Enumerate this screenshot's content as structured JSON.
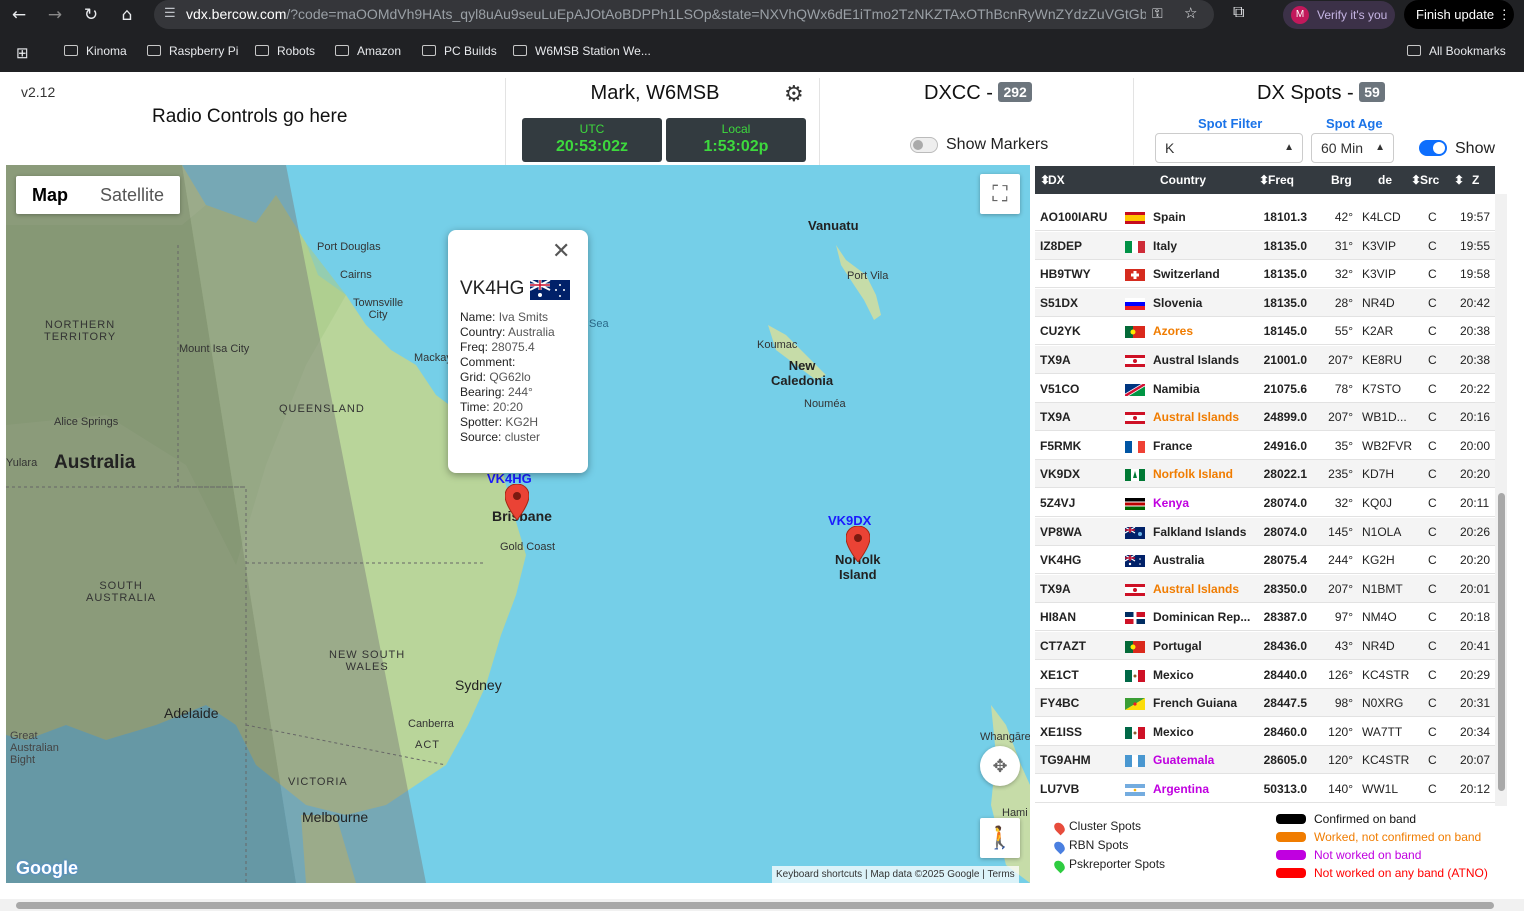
{
  "browser": {
    "url_host": "vdx.bercow.com",
    "url_rest": "/?code=maOOMdVh9HAts_qyl8uAu9seuLuEpAJOtAoBDPPh1LSOp&state=NXVhQWx6dE1iTmo2TzNKZTAxOThBcnRyWnZYdzZuVGtGbm...",
    "verify_label": "Verify it's you",
    "verify_avatar": "M",
    "finish_label": "Finish update",
    "bookmarks": [
      "Kinoma",
      "Raspberry Pi",
      "Robots",
      "Amazon",
      "PC Builds",
      "W6MSB Station We..."
    ],
    "all_bookmarks": "All Bookmarks"
  },
  "header": {
    "version": "v2.12",
    "radio_controls": "Radio Controls go here",
    "operator": "Mark, W6MSB",
    "utc_label": "UTC",
    "utc_time": "20:53:02z",
    "local_label": "Local",
    "local_time": "1:53:02p",
    "dxcc_title": "DXCC -",
    "dxcc_count": "292",
    "show_markers": "Show Markers",
    "spots_title": "DX Spots -",
    "spots_count": "59",
    "spot_filter_label": "Spot Filter",
    "spot_filter_value": "K",
    "spot_age_label": "Spot Age",
    "spot_age_value": "60 Min",
    "show_label": "Show"
  },
  "map": {
    "tab_map": "Map",
    "tab_satellite": "Satellite",
    "labels": {
      "port_douglas": "Port Douglas",
      "cairns": "Cairns",
      "townsville": "Townsville\nCity",
      "northern_territory": "NORTHERN\nTERRITORY",
      "mount_isa": "Mount Isa City",
      "mackay": "Mackay",
      "queensland": "QUEENSLAND",
      "alice_springs": "Alice Springs",
      "australia": "Australia",
      "yulara": "Yulara",
      "south_australia": "SOUTH\nAUSTRALIA",
      "new_south_wales": "NEW SOUTH\nWALES",
      "sydney": "Sydney",
      "adelaide": "Adelaide",
      "canberra": "Canberra",
      "act": "ACT",
      "victoria": "VICTORIA",
      "melbourne": "Melbourne",
      "great_bight": "Great\nAustralian\nBight",
      "gold_coast": "Gold Coast",
      "brisbane": "Brisbane",
      "vanuatu": "Vanuatu",
      "port_vila": "Port Vila",
      "koumac": "Koumac",
      "new_caledonia": "New\nCaledonia",
      "noumea": "Nouméa",
      "norfolk": "Norfolk\nIsland",
      "coral_sea": "Sea",
      "whangarei": "Whangārei",
      "hamilton": "Hami"
    },
    "callouts": {
      "vk4hg": "VK4HG",
      "vk9dx": "VK9DX"
    },
    "popup": {
      "call": "VK4HG",
      "lines": [
        [
          "Name:",
          "Iva Smits"
        ],
        [
          "Country:",
          "Australia"
        ],
        [
          "Freq:",
          "28075.4"
        ],
        [
          "Comment:",
          ""
        ],
        [
          "Grid:",
          "QG62lo"
        ],
        [
          "Bearing:",
          "244°"
        ],
        [
          "Time:",
          "20:20"
        ],
        [
          "Spotter:",
          "KG2H"
        ],
        [
          "Source:",
          "cluster"
        ]
      ]
    },
    "footer": [
      "Keyboard shortcuts",
      "Map data ©2025 Google",
      "Terms"
    ],
    "google": "Google"
  },
  "table": {
    "headers": [
      "DX",
      "Country",
      "Freq",
      "Brg",
      "de",
      "Src",
      "Z"
    ],
    "rows": [
      {
        "dx": "AO100IARU",
        "country": "Spain",
        "freq": "18101.3",
        "brg": "42°",
        "de": "K4LCD",
        "src": "C",
        "z": "19:57",
        "color": "#222",
        "flag": "es"
      },
      {
        "dx": "IZ8DEP",
        "country": "Italy",
        "freq": "18135.0",
        "brg": "31°",
        "de": "K3VIP",
        "src": "C",
        "z": "19:55",
        "color": "#222",
        "flag": "it"
      },
      {
        "dx": "HB9TWY",
        "country": "Switzerland",
        "freq": "18135.0",
        "brg": "32°",
        "de": "K3VIP",
        "src": "C",
        "z": "19:58",
        "color": "#222",
        "flag": "ch"
      },
      {
        "dx": "S51DX",
        "country": "Slovenia",
        "freq": "18135.0",
        "brg": "28°",
        "de": "NR4D",
        "src": "C",
        "z": "20:42",
        "color": "#222",
        "flag": "si"
      },
      {
        "dx": "CU2YK",
        "country": "Azores",
        "freq": "18145.0",
        "brg": "55°",
        "de": "K2AR",
        "src": "C",
        "z": "20:38",
        "color": "#f07c00",
        "flag": "pt"
      },
      {
        "dx": "TX9A",
        "country": "Austral Islands",
        "freq": "21001.0",
        "brg": "207°",
        "de": "KE8RU",
        "src": "C",
        "z": "20:38",
        "color": "#222",
        "flag": "pf"
      },
      {
        "dx": "V51CO",
        "country": "Namibia",
        "freq": "21075.6",
        "brg": "78°",
        "de": "K7STO",
        "src": "C",
        "z": "20:22",
        "color": "#222",
        "flag": "na"
      },
      {
        "dx": "TX9A",
        "country": "Austral Islands",
        "freq": "24899.0",
        "brg": "207°",
        "de": "WB1D...",
        "src": "C",
        "z": "20:16",
        "color": "#f07c00",
        "flag": "pf"
      },
      {
        "dx": "F5RMK",
        "country": "France",
        "freq": "24916.0",
        "brg": "35°",
        "de": "WB2FVR",
        "src": "C",
        "z": "20:00",
        "color": "#222",
        "flag": "fr"
      },
      {
        "dx": "VK9DX",
        "country": "Norfolk Island",
        "freq": "28022.1",
        "brg": "235°",
        "de": "KD7H",
        "src": "C",
        "z": "20:20",
        "color": "#f07c00",
        "flag": "nf"
      },
      {
        "dx": "5Z4VJ",
        "country": "Kenya",
        "freq": "28074.0",
        "brg": "32°",
        "de": "KQ0J",
        "src": "C",
        "z": "20:11",
        "color": "#c000e0",
        "flag": "ke"
      },
      {
        "dx": "VP8WA",
        "country": "Falkland Islands",
        "freq": "28074.0",
        "brg": "145°",
        "de": "N1OLA",
        "src": "C",
        "z": "20:26",
        "color": "#222",
        "flag": "fk"
      },
      {
        "dx": "VK4HG",
        "country": "Australia",
        "freq": "28075.4",
        "brg": "244°",
        "de": "KG2H",
        "src": "C",
        "z": "20:20",
        "color": "#222",
        "flag": "au"
      },
      {
        "dx": "TX9A",
        "country": "Austral Islands",
        "freq": "28350.0",
        "brg": "207°",
        "de": "N1BMT",
        "src": "C",
        "z": "20:01",
        "color": "#f07c00",
        "flag": "pf"
      },
      {
        "dx": "HI8AN",
        "country": "Dominican Rep...",
        "freq": "28387.0",
        "brg": "97°",
        "de": "NM4O",
        "src": "C",
        "z": "20:18",
        "color": "#222",
        "flag": "do"
      },
      {
        "dx": "CT7AZT",
        "country": "Portugal",
        "freq": "28436.0",
        "brg": "43°",
        "de": "NR4D",
        "src": "C",
        "z": "20:41",
        "color": "#222",
        "flag": "pt"
      },
      {
        "dx": "XE1CT",
        "country": "Mexico",
        "freq": "28440.0",
        "brg": "126°",
        "de": "KC4STR",
        "src": "C",
        "z": "20:29",
        "color": "#222",
        "flag": "mx"
      },
      {
        "dx": "FY4BC",
        "country": "French Guiana",
        "freq": "28447.5",
        "brg": "98°",
        "de": "N0XRG",
        "src": "C",
        "z": "20:31",
        "color": "#222",
        "flag": "gf"
      },
      {
        "dx": "XE1ISS",
        "country": "Mexico",
        "freq": "28460.0",
        "brg": "120°",
        "de": "WA7TT",
        "src": "C",
        "z": "20:34",
        "color": "#222",
        "flag": "mx"
      },
      {
        "dx": "TG9AHM",
        "country": "Guatemala",
        "freq": "28605.0",
        "brg": "120°",
        "de": "KC4STR",
        "src": "C",
        "z": "20:07",
        "color": "#c000e0",
        "flag": "gt"
      },
      {
        "dx": "LU7VB",
        "country": "Argentina",
        "freq": "50313.0",
        "brg": "140°",
        "de": "WW1L",
        "src": "C",
        "z": "20:12",
        "color": "#c000e0",
        "flag": "ar"
      }
    ]
  },
  "legend": {
    "pins": [
      {
        "label": "Cluster Spots",
        "color": "#e74c3c"
      },
      {
        "label": "RBN Spots",
        "color": "#4a7fe0"
      },
      {
        "label": "Pskreporter Spots",
        "color": "#2ecc40"
      }
    ],
    "bars": [
      {
        "label": "Confirmed on band",
        "color": "#000000"
      },
      {
        "label": "Worked, not confirmed on band",
        "color": "#f07c00"
      },
      {
        "label": "Not worked on band",
        "color": "#c000e0"
      },
      {
        "label": "Not worked on any band (ATNO)",
        "color": "#ff0000"
      }
    ]
  }
}
